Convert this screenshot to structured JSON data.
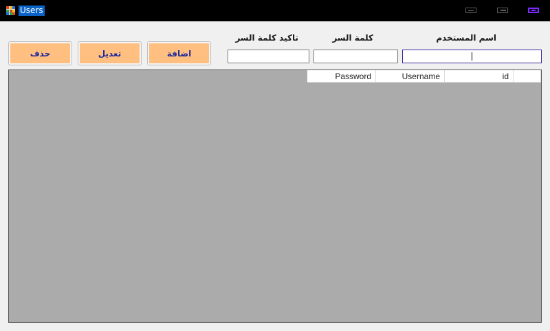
{
  "window": {
    "title": "Users",
    "icon": "app-grid-icon",
    "controls": {
      "minimize": "minimize-icon",
      "maximize": "maximize-icon",
      "close": "close-icon"
    },
    "accent_color": "#7a2bff"
  },
  "form": {
    "username_label": "اسم المستخدم",
    "password_label": "كلمة السر",
    "confirm_label": "تاكيد كلمة السر",
    "username_value": "",
    "password_value": "",
    "confirm_value": ""
  },
  "buttons": {
    "add": "اضافة",
    "edit": "تعديل",
    "delete": "حذف",
    "color": "#ffbf80",
    "text_color": "#1e2a9c"
  },
  "table": {
    "columns": [
      "id",
      "Username",
      "Password"
    ],
    "rows": []
  }
}
